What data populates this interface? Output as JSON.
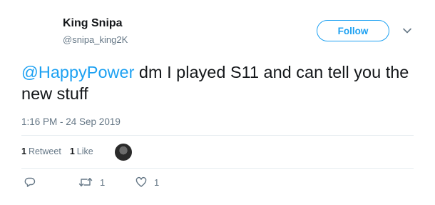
{
  "user": {
    "display_name": "King Snipa",
    "handle": "@snipa_king2K"
  },
  "follow_button": {
    "label": "Follow"
  },
  "tweet": {
    "mention": "@HappyPower",
    "text": " dm I played S11 and can tell you the new stuff",
    "timestamp": "1:16 PM - 24 Sep 2019"
  },
  "stats": {
    "retweet_count": "1",
    "retweet_label": "Retweet",
    "like_count": "1",
    "like_label": "Like"
  },
  "actions": {
    "retweet_count": "1",
    "like_count": "1"
  },
  "icons": {
    "reply": "reply-icon",
    "retweet": "retweet-icon",
    "like": "heart-icon",
    "more": "chevron-down-icon"
  },
  "colors": {
    "accent": "#1da1f2",
    "muted": "#657786",
    "text": "#14171a"
  }
}
